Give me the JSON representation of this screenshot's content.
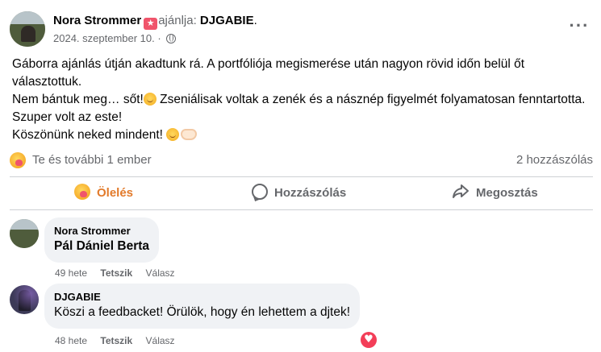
{
  "post": {
    "author": "Nora Strommer",
    "recommend_text": "ajánlja:",
    "recommend_target": "DJGABIE",
    "date": "2024. szeptember 10.",
    "date_sep": "·",
    "more_icon": "more-horizontal-icon",
    "body": {
      "line1": "Gáborra ajánlás útján akadtunk rá. A portfóliója megismerése után nagyon rövid időn belül őt választottuk.",
      "line2a": "Nem bántuk meg… sőt!",
      "line2b": " Zseniálisak voltak a zenék és a násznép figyelmét folyamatosan fenntartotta. Szuper volt az este!",
      "line3": "Köszönünk neked mindent! "
    }
  },
  "reactions": {
    "summary": "Te és további 1 ember",
    "comment_count": "2 hozzászólás",
    "icon": "care-reaction-icon"
  },
  "actions": {
    "like": "Ölelés",
    "comment": "Hozzászólás",
    "share": "Megosztás"
  },
  "comments": [
    {
      "author": "Nora Strommer",
      "text": "Pál Dániel Berta",
      "time": "49 hete",
      "like": "Tetszik",
      "reply": "Válasz"
    },
    {
      "author": "DJGABIE",
      "text": "Köszi a feedbacket! Örülök, hogy én lehettem a djtek!",
      "time": "48 hete",
      "like": "Tetszik",
      "reply": "Válasz",
      "reaction_icon": "heart-reaction-icon"
    }
  ],
  "colors": {
    "accent_hug": "#e27a2a",
    "secondary_text": "#65676b",
    "bubble_bg": "#f0f2f5",
    "heart": "#f33e58"
  }
}
